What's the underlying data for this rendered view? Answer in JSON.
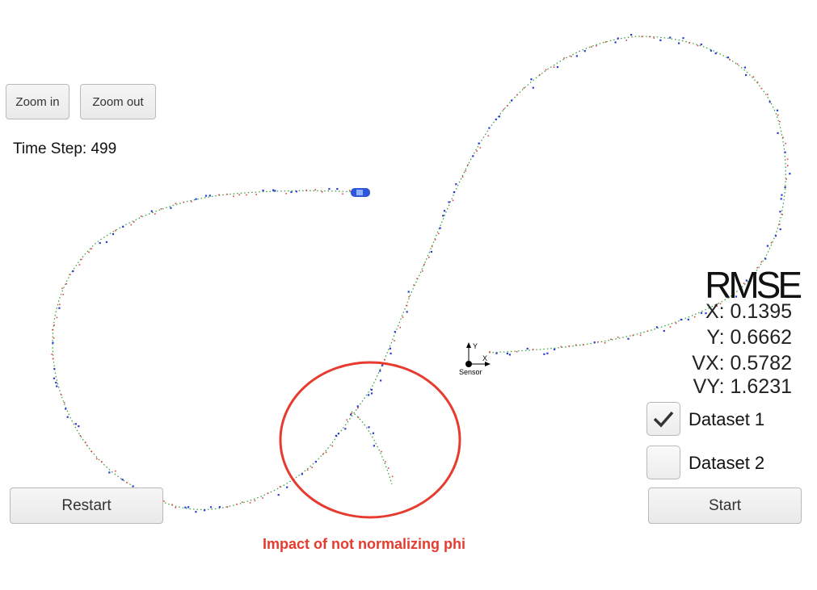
{
  "controls": {
    "zoom_in": "Zoom in",
    "zoom_out": "Zoom out",
    "restart": "Restart",
    "start": "Start"
  },
  "status": {
    "time_step_label": "Time Step: 499"
  },
  "rmse": {
    "title": "RMSE",
    "x": "X: 0.1395",
    "y": "Y: 0.6662",
    "vx": "VX: 0.5782",
    "vy": "VY: 1.6231"
  },
  "datasets": [
    {
      "label": "Dataset 1",
      "checked": true
    },
    {
      "label": "Dataset 2",
      "checked": false
    }
  ],
  "sensor": {
    "label": "Sensor",
    "axis_x": "X",
    "axis_y": "Y"
  },
  "annotation": {
    "text": "Impact of not normalizing phi",
    "color": "#e63b2e"
  },
  "colors": {
    "ground_truth": "#2e9a2e",
    "lidar": "#e04040",
    "radar": "#2b3bd6",
    "car": "#2f56d8"
  }
}
